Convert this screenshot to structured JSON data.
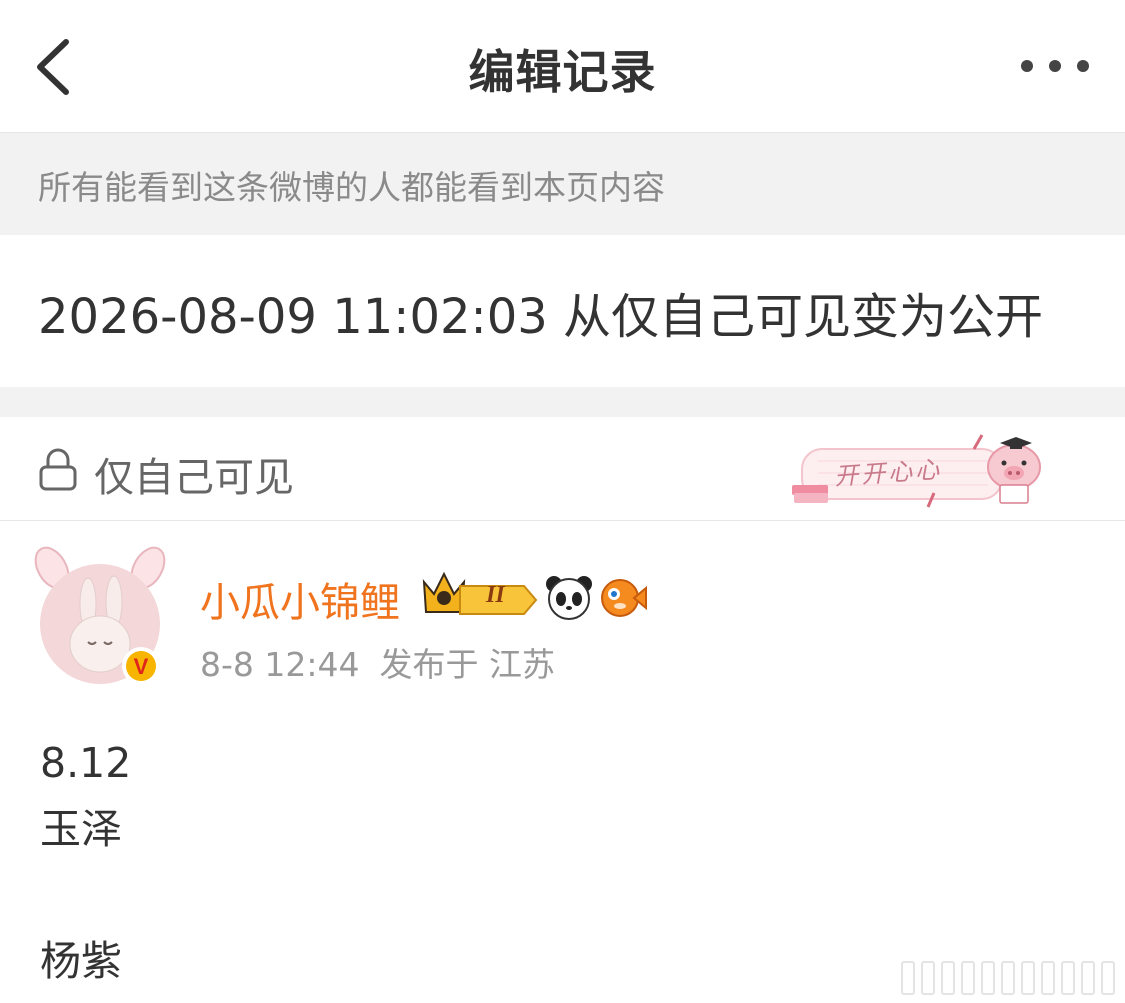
{
  "header": {
    "title": "编辑记录",
    "back_icon": "chevron-left-icon",
    "more_icon": "more-dots-icon"
  },
  "notice": {
    "text": "所有能看到这条微博的人都能看到本页内容"
  },
  "record": {
    "text": "2026-08-09 11:02:03 从仅自己可见变为公开"
  },
  "visibility": {
    "label": "仅自己可见",
    "icon": "lock-icon",
    "sticker_text": "开开心心"
  },
  "post": {
    "username": "小瓜小锦鲤",
    "verified_badge": "V",
    "level_badge": "II",
    "time": "8-8 12:44",
    "location": "发布于 江苏",
    "lines": [
      "8.12",
      "玉泽",
      "",
      "杨紫"
    ]
  },
  "colors": {
    "username": "#f0731e",
    "notice_bg": "#f2f2f2",
    "verified": "#f7b500"
  }
}
